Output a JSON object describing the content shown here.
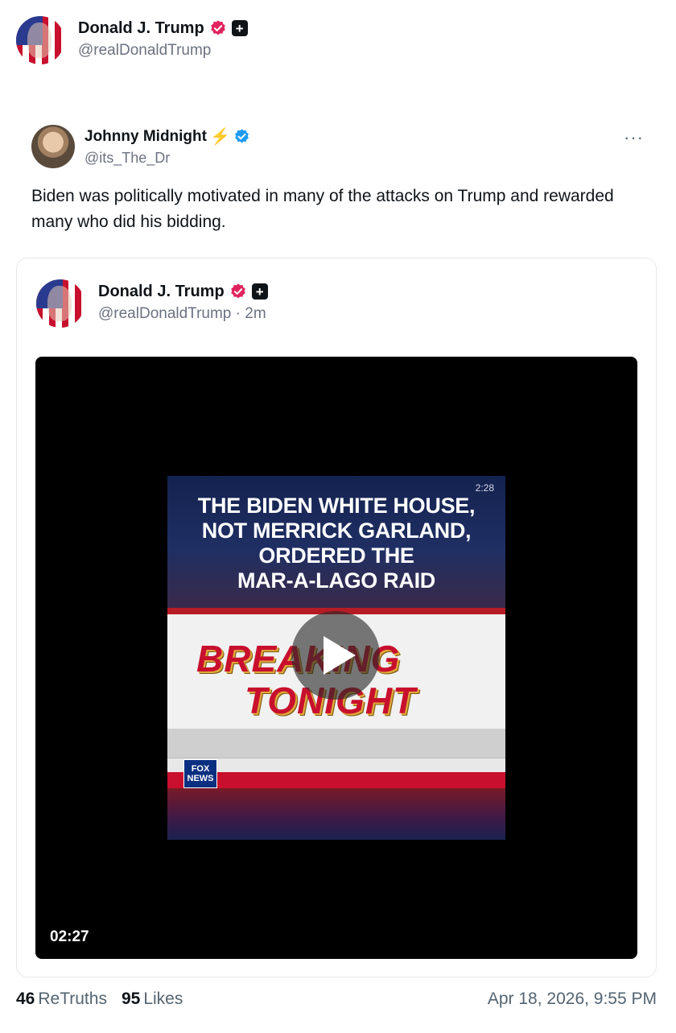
{
  "post": {
    "author": {
      "display_name": "Donald J. Trump",
      "handle": "@realDonaldTrump",
      "verified_badge_color": "#e0245e"
    },
    "quoted_reply": {
      "display_name": "Johnny Midnight",
      "bolt": "⚡",
      "handle": "@its_The_Dr",
      "verified_badge_color": "#1d9bf0",
      "more": "···",
      "text": "Biden was politically motivated in many of the attacks on Trump and rewarded many who did his bidding."
    },
    "embed": {
      "author": {
        "display_name": "Donald J. Trump",
        "handle": "@realDonaldTrump · 2m"
      },
      "video": {
        "duration": "02:27",
        "thumbnail": {
          "time": "2:28",
          "headline_lines": [
            "THE BIDEN WHITE HOUSE,",
            "NOT MERRICK GARLAND,",
            "ORDERED THE",
            "MAR-A-LAGO RAID"
          ],
          "breaking": "BREAKING",
          "tonight": "TONIGHT",
          "logo": "FOX NEWS"
        }
      }
    },
    "footer": {
      "retruths_count": "46",
      "retruths_label": "ReTruths",
      "likes_count": "95",
      "likes_label": "Likes",
      "timestamp": "Apr 18, 2026, 9:55 PM"
    }
  }
}
